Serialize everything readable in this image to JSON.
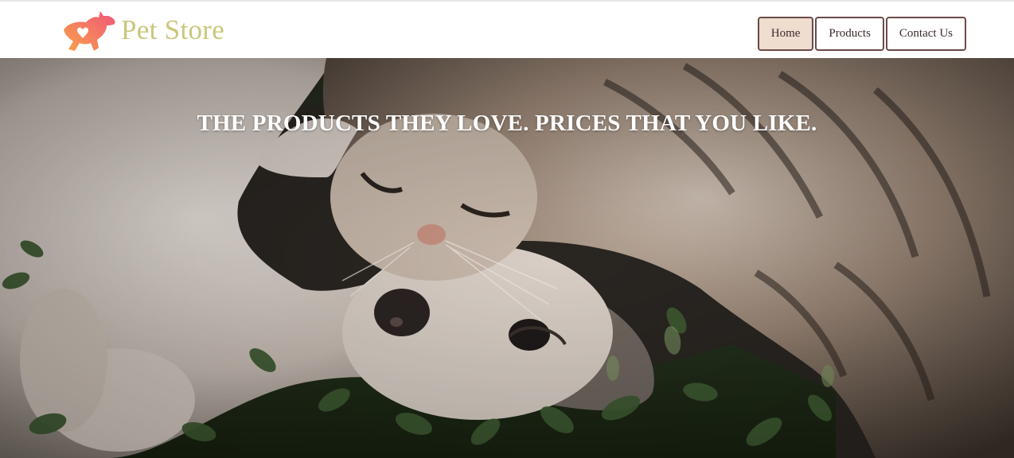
{
  "brand": {
    "name": "Pet Store",
    "logo_icon": "pet-dog-heart-icon",
    "name_color": "#c9c77c",
    "logo_color": "#f47a5c"
  },
  "nav": {
    "items": [
      {
        "label": "Home",
        "active": true
      },
      {
        "label": "Products",
        "active": false
      },
      {
        "label": "Contact Us",
        "active": false
      }
    ],
    "border_color": "#6b4a48",
    "active_bg": "#efddd0"
  },
  "hero": {
    "tagline": "THE PRODUCTS THEY LOVE. PRICES THAT YOU LIKE.",
    "image": "photo-of-cat-and-dog-cuddling-on-grass"
  }
}
